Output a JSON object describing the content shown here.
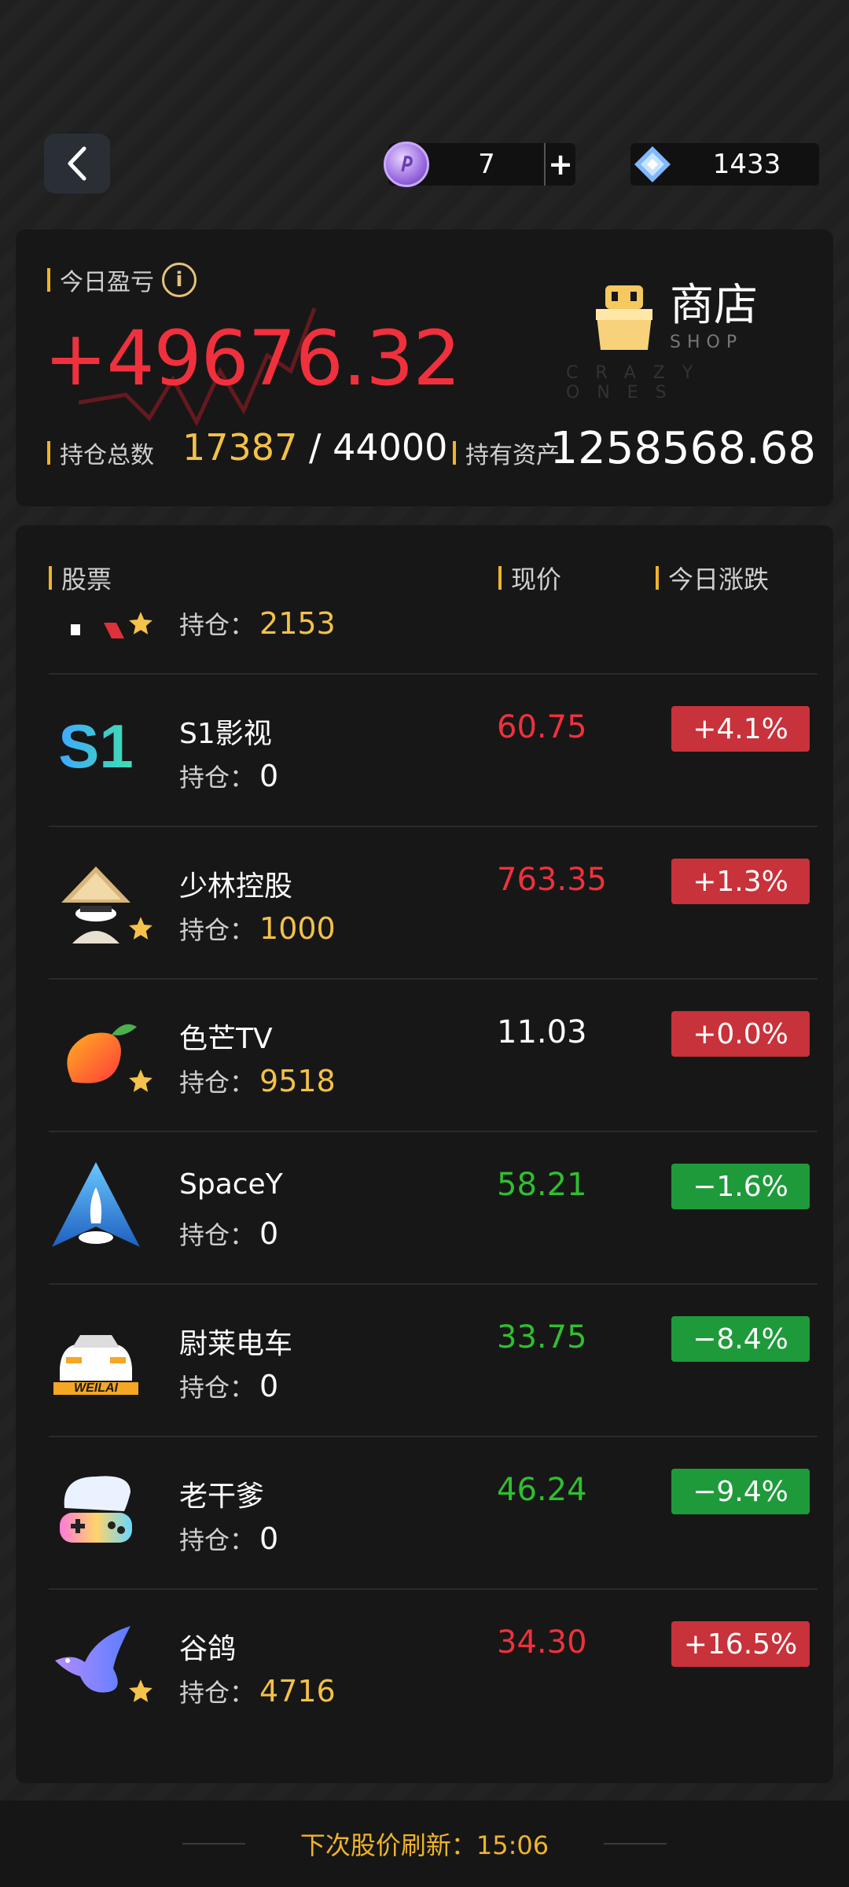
{
  "top_bar": {
    "coins": {
      "value": "7",
      "add_label": "+"
    },
    "gems": {
      "value": "1433"
    }
  },
  "summary": {
    "pnl_label": "今日盈亏",
    "pnl_value": "+49676.32",
    "shop": {
      "title": "商店",
      "subtitle": "SHOP",
      "watermark": "CRAZY ONES"
    },
    "holdings_label": "持仓总数",
    "holdings_current": "17387",
    "holdings_sep": " / ",
    "holdings_max": "44000",
    "assets_label": "持有资产",
    "assets_value": "1258568.68"
  },
  "list": {
    "headers": {
      "stock": "股票",
      "price": "现价",
      "change": "今日涨跌"
    },
    "hold_prefix": "持仓：",
    "partial_row": {
      "holding": "2153"
    },
    "rows": [
      {
        "name": "S1影视",
        "holding": "0",
        "price": "60.75",
        "change": "+4.1%",
        "direction": "up",
        "star": false,
        "logo": "s1-logo-icon"
      },
      {
        "name": "少林控股",
        "holding": "1000",
        "price": "763.35",
        "change": "+1.3%",
        "direction": "up",
        "star": true,
        "logo": "monk-logo-icon"
      },
      {
        "name": "色芒TV",
        "holding": "9518",
        "price": "11.03",
        "change": "+0.0%",
        "direction": "flat",
        "star": true,
        "logo": "mango-logo-icon"
      },
      {
        "name": "SpaceY",
        "holding": "0",
        "price": "58.21",
        "change": "−1.6%",
        "direction": "down",
        "star": false,
        "logo": "rocket-logo-icon"
      },
      {
        "name": "尉莱电车",
        "holding": "0",
        "price": "33.75",
        "change": "−8.4%",
        "direction": "down",
        "star": false,
        "logo": "car-logo-icon",
        "logo_text": "WEILAI"
      },
      {
        "name": "老干爹",
        "holding": "0",
        "price": "46.24",
        "change": "−9.4%",
        "direction": "down",
        "star": false,
        "logo": "gamer-logo-icon"
      },
      {
        "name": "谷鸽",
        "holding": "4716",
        "price": "34.30",
        "change": "+16.5%",
        "direction": "up",
        "star": true,
        "logo": "dove-logo-icon"
      }
    ]
  },
  "footer": {
    "refresh_text": "下次股价刷新：15:06"
  },
  "colors": {
    "up": "#f0313d",
    "down": "#2fbf2f",
    "accent": "#f0b429",
    "gold": "#f3c148"
  }
}
